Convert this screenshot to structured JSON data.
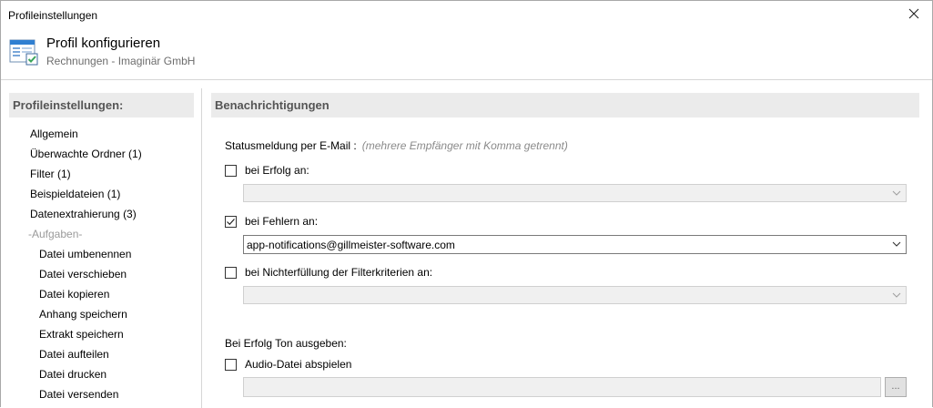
{
  "window": {
    "title": "Profileinstellungen"
  },
  "header": {
    "title": "Profil konfigurieren",
    "subtitle": "Rechnungen - Imaginär GmbH"
  },
  "sidebar": {
    "title": "Profileinstellungen:",
    "items": [
      {
        "label": "Allgemein"
      },
      {
        "label": "Überwachte Ordner (1)"
      },
      {
        "label": "Filter (1)"
      },
      {
        "label": "Beispieldateien (1)"
      },
      {
        "label": "Datenextrahierung (3)"
      }
    ],
    "group_label": "-Aufgaben-",
    "tasks": [
      {
        "label": "Datei umbenennen"
      },
      {
        "label": "Datei verschieben"
      },
      {
        "label": "Datei kopieren"
      },
      {
        "label": "Anhang speichern"
      },
      {
        "label": "Extrakt speichern"
      },
      {
        "label": "Datei aufteilen"
      },
      {
        "label": "Datei drucken"
      },
      {
        "label": "Datei versenden"
      }
    ]
  },
  "notifications": {
    "title": "Benachrichtigungen",
    "status_label": "Statusmeldung per E-Mail :",
    "status_hint": "(mehrere Empfänger mit Komma getrennt)",
    "on_success": {
      "label": "bei Erfolg an:",
      "checked": false,
      "value": ""
    },
    "on_error": {
      "label": "bei Fehlern an:",
      "checked": true,
      "value": "app-notifications@gillmeister-software.com"
    },
    "on_filter_fail": {
      "label": "bei Nichterfüllung der Filterkriterien an:",
      "checked": false,
      "value": ""
    },
    "sound_label": "Bei Erfolg Ton ausgeben:",
    "audio": {
      "label": "Audio-Datei abspielen",
      "checked": false,
      "path": "",
      "browse_label": "..."
    }
  },
  "icons": {
    "close": "close-icon",
    "profile": "profile-settings-icon",
    "check": "checkmark-icon",
    "dropdown": "chevron-down-icon"
  },
  "colors": {
    "section_bg": "#ebebeb",
    "accent_green": "#3aa55b",
    "icon_blue": "#2f7fd1"
  }
}
